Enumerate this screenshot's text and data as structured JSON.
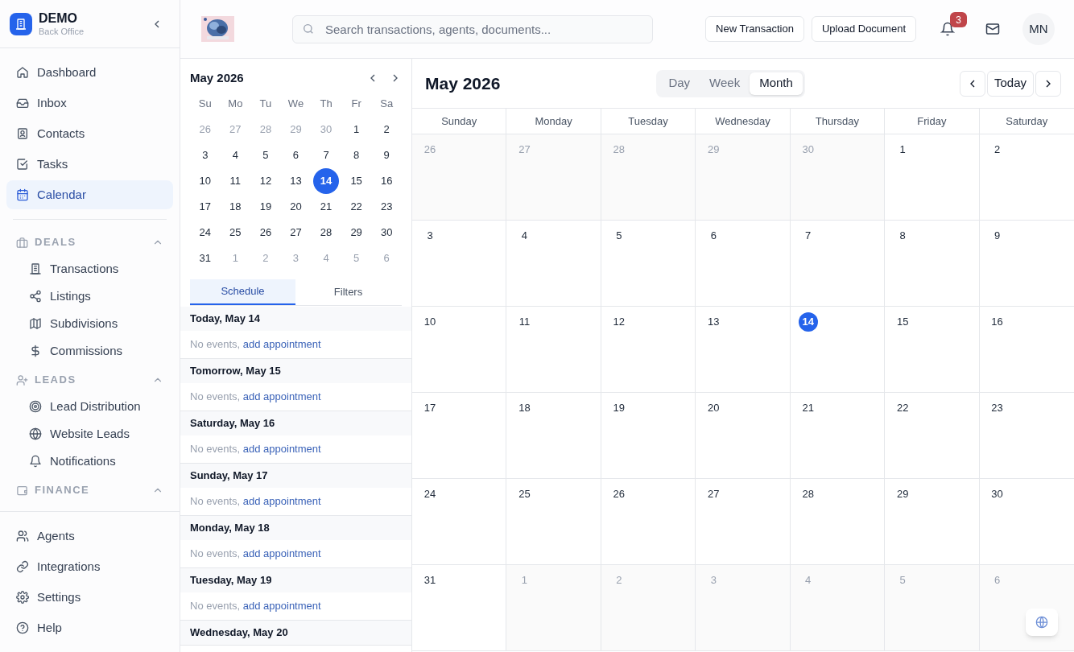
{
  "sidebar": {
    "brand": {
      "name": "DEMO",
      "subtitle": "Back Office"
    },
    "nav": [
      {
        "label": "Dashboard",
        "selected": false
      },
      {
        "label": "Inbox",
        "selected": false
      },
      {
        "label": "Contacts",
        "selected": false
      },
      {
        "label": "Tasks",
        "selected": false
      },
      {
        "label": "Calendar",
        "selected": true
      }
    ],
    "sections": [
      {
        "title": "DEALS",
        "expanded": true,
        "items": [
          {
            "label": "Transactions"
          },
          {
            "label": "Listings"
          },
          {
            "label": "Subdivisions"
          },
          {
            "label": "Commissions"
          }
        ]
      },
      {
        "title": "LEADS",
        "expanded": true,
        "items": [
          {
            "label": "Lead Distribution"
          },
          {
            "label": "Website Leads"
          },
          {
            "label": "Notifications"
          }
        ]
      },
      {
        "title": "FINANCE",
        "expanded": true
      }
    ],
    "footer_nav": [
      {
        "label": "Agents"
      },
      {
        "label": "Integrations"
      },
      {
        "label": "Settings"
      },
      {
        "label": "Help"
      }
    ]
  },
  "header": {
    "search": {
      "placeholder": "Search transactions, agents, documents..."
    },
    "buttons": [
      "New Transaction",
      "Upload Document"
    ],
    "notification_count": "3",
    "avatar": "MN"
  },
  "mini_calendar": {
    "title": "May 2026",
    "weekdays": [
      "Su",
      "Mo",
      "Tu",
      "We",
      "Th",
      "Fr",
      "Sa"
    ],
    "days": [
      {
        "label": "26",
        "in_month": false,
        "selected": false
      },
      {
        "label": "27",
        "in_month": false,
        "selected": false
      },
      {
        "label": "28",
        "in_month": false,
        "selected": false
      },
      {
        "label": "29",
        "in_month": false,
        "selected": false
      },
      {
        "label": "30",
        "in_month": false,
        "selected": false
      },
      {
        "label": "1",
        "in_month": true,
        "selected": false
      },
      {
        "label": "2",
        "in_month": true,
        "selected": false
      },
      {
        "label": "3",
        "in_month": true,
        "selected": false
      },
      {
        "label": "4",
        "in_month": true,
        "selected": false
      },
      {
        "label": "5",
        "in_month": true,
        "selected": false
      },
      {
        "label": "6",
        "in_month": true,
        "selected": false
      },
      {
        "label": "7",
        "in_month": true,
        "selected": false
      },
      {
        "label": "8",
        "in_month": true,
        "selected": false
      },
      {
        "label": "9",
        "in_month": true,
        "selected": false
      },
      {
        "label": "10",
        "in_month": true,
        "selected": false
      },
      {
        "label": "11",
        "in_month": true,
        "selected": false
      },
      {
        "label": "12",
        "in_month": true,
        "selected": false
      },
      {
        "label": "13",
        "in_month": true,
        "selected": false
      },
      {
        "label": "14",
        "in_month": true,
        "selected": true
      },
      {
        "label": "15",
        "in_month": true,
        "selected": false
      },
      {
        "label": "16",
        "in_month": true,
        "selected": false
      },
      {
        "label": "17",
        "in_month": true,
        "selected": false
      },
      {
        "label": "18",
        "in_month": true,
        "selected": false
      },
      {
        "label": "19",
        "in_month": true,
        "selected": false
      },
      {
        "label": "20",
        "in_month": true,
        "selected": false
      },
      {
        "label": "21",
        "in_month": true,
        "selected": false
      },
      {
        "label": "22",
        "in_month": true,
        "selected": false
      },
      {
        "label": "23",
        "in_month": true,
        "selected": false
      },
      {
        "label": "24",
        "in_month": true,
        "selected": false
      },
      {
        "label": "25",
        "in_month": true,
        "selected": false
      },
      {
        "label": "26",
        "in_month": true,
        "selected": false
      },
      {
        "label": "27",
        "in_month": true,
        "selected": false
      },
      {
        "label": "28",
        "in_month": true,
        "selected": false
      },
      {
        "label": "29",
        "in_month": true,
        "selected": false
      },
      {
        "label": "30",
        "in_month": true,
        "selected": false
      },
      {
        "label": "31",
        "in_month": true,
        "selected": false
      },
      {
        "label": "1",
        "in_month": false,
        "selected": false
      },
      {
        "label": "2",
        "in_month": false,
        "selected": false
      },
      {
        "label": "3",
        "in_month": false,
        "selected": false
      },
      {
        "label": "4",
        "in_month": false,
        "selected": false
      },
      {
        "label": "5",
        "in_month": false,
        "selected": false
      },
      {
        "label": "6",
        "in_month": false,
        "selected": false
      }
    ]
  },
  "panel_tabs": [
    {
      "label": "Schedule",
      "selected": true
    },
    {
      "label": "Filters",
      "selected": false
    }
  ],
  "schedule": [
    {
      "heading": "Today, May 14",
      "empty_text": "No events,",
      "link": "add appointment"
    },
    {
      "heading": "Tomorrow, May 15",
      "empty_text": "No events,",
      "link": "add appointment"
    },
    {
      "heading": "Saturday, May 16",
      "empty_text": "No events,",
      "link": "add appointment"
    },
    {
      "heading": "Sunday, May 17",
      "empty_text": "No events,",
      "link": "add appointment"
    },
    {
      "heading": "Monday, May 18",
      "empty_text": "No events,",
      "link": "add appointment"
    },
    {
      "heading": "Tuesday, May 19",
      "empty_text": "No events,",
      "link": "add appointment"
    },
    {
      "heading": "Wednesday, May 20"
    }
  ],
  "month_view": {
    "title": "May 2026",
    "views": [
      {
        "label": "Day",
        "selected": false
      },
      {
        "label": "Week",
        "selected": false
      },
      {
        "label": "Month",
        "selected": true
      }
    ],
    "today_button": "Today",
    "weekdays": [
      "Sunday",
      "Monday",
      "Tuesday",
      "Wednesday",
      "Thursday",
      "Friday",
      "Saturday"
    ],
    "cells": [
      {
        "label": "26",
        "in_month": false,
        "today": false
      },
      {
        "label": "27",
        "in_month": false,
        "today": false
      },
      {
        "label": "28",
        "in_month": false,
        "today": false
      },
      {
        "label": "29",
        "in_month": false,
        "today": false
      },
      {
        "label": "30",
        "in_month": false,
        "today": false
      },
      {
        "label": "1",
        "in_month": true,
        "today": false
      },
      {
        "label": "2",
        "in_month": true,
        "today": false
      },
      {
        "label": "3",
        "in_month": true,
        "today": false
      },
      {
        "label": "4",
        "in_month": true,
        "today": false
      },
      {
        "label": "5",
        "in_month": true,
        "today": false
      },
      {
        "label": "6",
        "in_month": true,
        "today": false
      },
      {
        "label": "7",
        "in_month": true,
        "today": false
      },
      {
        "label": "8",
        "in_month": true,
        "today": false
      },
      {
        "label": "9",
        "in_month": true,
        "today": false
      },
      {
        "label": "10",
        "in_month": true,
        "today": false
      },
      {
        "label": "11",
        "in_month": true,
        "today": false
      },
      {
        "label": "12",
        "in_month": true,
        "today": false
      },
      {
        "label": "13",
        "in_month": true,
        "today": false
      },
      {
        "label": "14",
        "in_month": true,
        "today": true
      },
      {
        "label": "15",
        "in_month": true,
        "today": false
      },
      {
        "label": "16",
        "in_month": true,
        "today": false
      },
      {
        "label": "17",
        "in_month": true,
        "today": false
      },
      {
        "label": "18",
        "in_month": true,
        "today": false
      },
      {
        "label": "19",
        "in_month": true,
        "today": false
      },
      {
        "label": "20",
        "in_month": true,
        "today": false
      },
      {
        "label": "21",
        "in_month": true,
        "today": false
      },
      {
        "label": "22",
        "in_month": true,
        "today": false
      },
      {
        "label": "23",
        "in_month": true,
        "today": false
      },
      {
        "label": "24",
        "in_month": true,
        "today": false
      },
      {
        "label": "25",
        "in_month": true,
        "today": false
      },
      {
        "label": "26",
        "in_month": true,
        "today": false
      },
      {
        "label": "27",
        "in_month": true,
        "today": false
      },
      {
        "label": "28",
        "in_month": true,
        "today": false
      },
      {
        "label": "29",
        "in_month": true,
        "today": false
      },
      {
        "label": "30",
        "in_month": true,
        "today": false
      },
      {
        "label": "31",
        "in_month": true,
        "today": false
      },
      {
        "label": "1",
        "in_month": false,
        "today": false
      },
      {
        "label": "2",
        "in_month": false,
        "today": false
      },
      {
        "label": "3",
        "in_month": false,
        "today": false
      },
      {
        "label": "4",
        "in_month": false,
        "today": false
      },
      {
        "label": "5",
        "in_month": false,
        "today": false
      },
      {
        "label": "6",
        "in_month": false,
        "today": false
      }
    ]
  }
}
